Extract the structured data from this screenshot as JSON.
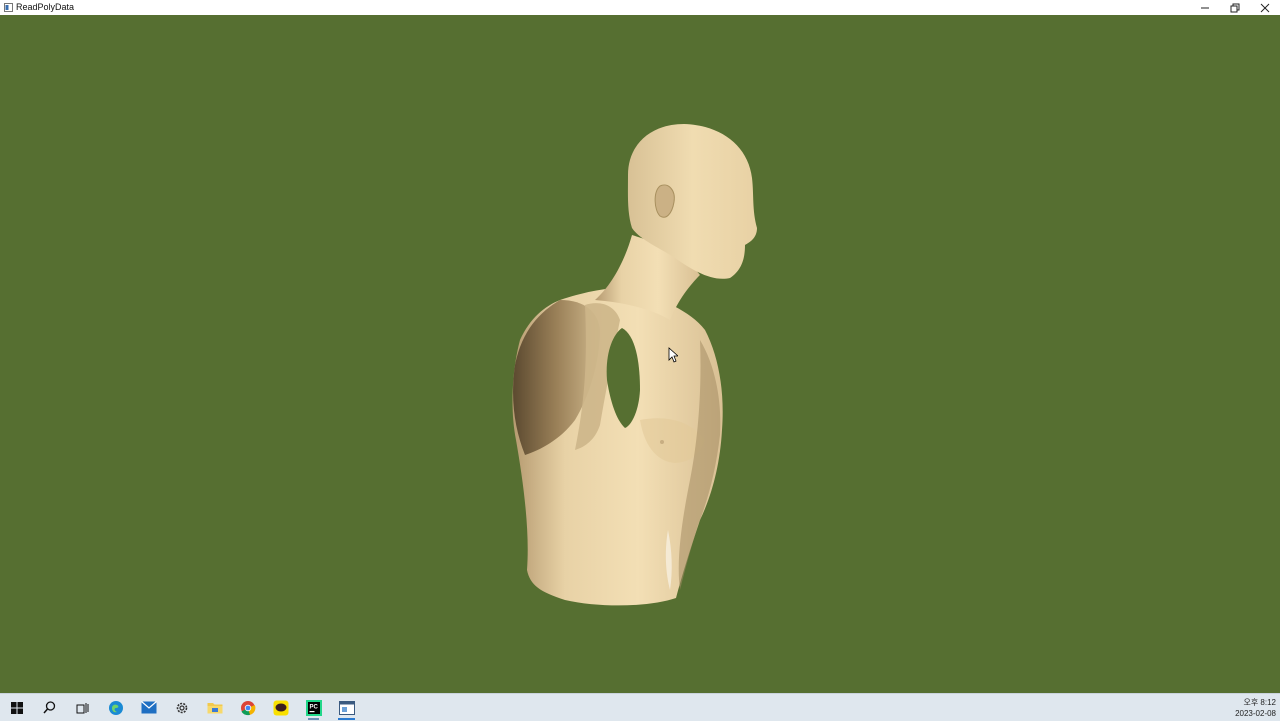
{
  "window": {
    "title": "ReadPolyData",
    "controls": [
      "minimize",
      "restore",
      "close"
    ]
  },
  "viewport": {
    "background_color": "#566f31",
    "model_color": "#eed9ae",
    "content": "3D polydata model"
  },
  "taskbar": {
    "items": [
      {
        "name": "start-button",
        "icon": "windows-logo-icon"
      },
      {
        "name": "search-button",
        "icon": "search-icon"
      },
      {
        "name": "task-view-button",
        "icon": "task-view-icon"
      },
      {
        "name": "edge-button",
        "icon": "edge-icon"
      },
      {
        "name": "mail-button",
        "icon": "mail-icon"
      },
      {
        "name": "settings-button",
        "icon": "gear-icon"
      },
      {
        "name": "file-explorer-button",
        "icon": "folder-icon"
      },
      {
        "name": "chrome-button",
        "icon": "chrome-icon"
      },
      {
        "name": "kakaotalk-button",
        "icon": "talk-icon"
      },
      {
        "name": "pycharm-button",
        "icon": "pycharm-icon"
      },
      {
        "name": "readpolydata-button",
        "icon": "app-window-icon"
      }
    ],
    "clock": {
      "time": "오후 8:12",
      "date": "2023-02-08"
    }
  }
}
